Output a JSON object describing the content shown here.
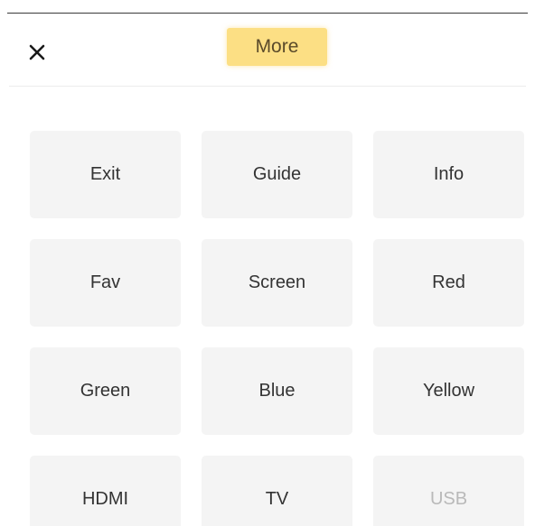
{
  "header": {
    "title": "More",
    "close_icon": "close-icon",
    "title_highlight_color": "#fcdf84"
  },
  "keys": [
    {
      "label": "Exit",
      "enabled": true
    },
    {
      "label": "Guide",
      "enabled": true
    },
    {
      "label": "Info",
      "enabled": true
    },
    {
      "label": "Fav",
      "enabled": true
    },
    {
      "label": "Screen",
      "enabled": true
    },
    {
      "label": "Red",
      "enabled": true
    },
    {
      "label": "Green",
      "enabled": true
    },
    {
      "label": "Blue",
      "enabled": true
    },
    {
      "label": "Yellow",
      "enabled": true
    },
    {
      "label": "HDMI",
      "enabled": true
    },
    {
      "label": "TV",
      "enabled": true
    },
    {
      "label": "USB",
      "enabled": false
    }
  ],
  "colors": {
    "key_background": "#f4f4f4",
    "key_text": "#333333",
    "key_text_disabled": "#b9b9b9"
  }
}
